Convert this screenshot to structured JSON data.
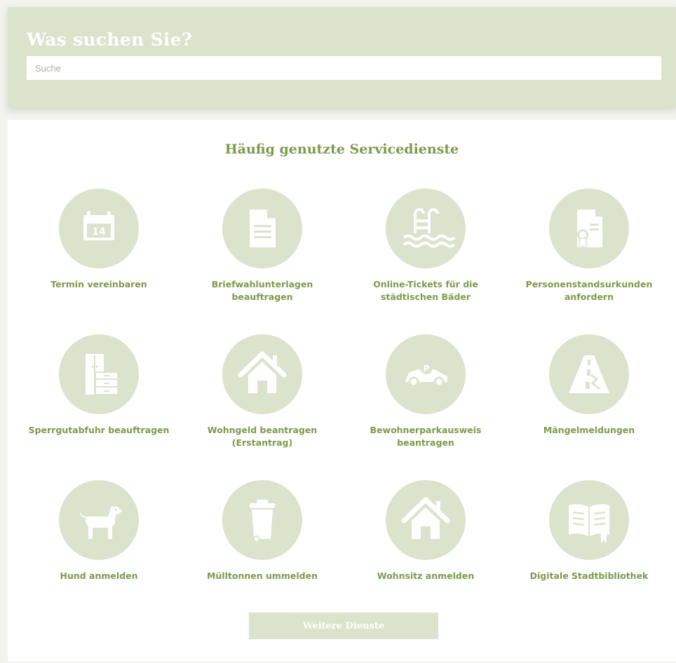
{
  "search": {
    "heading": "Was suchen Sie?",
    "placeholder": "Suche"
  },
  "services": {
    "title": "Häufig genutzte Servicedienste",
    "items": [
      {
        "label": "Termin vereinbaren",
        "icon": "calendar-icon",
        "calendar_day": "14"
      },
      {
        "label": "Briefwahlunterlagen beauftragen",
        "icon": "document-icon"
      },
      {
        "label": "Online-Tickets für die städtischen Bäder",
        "icon": "swimming-pool-icon"
      },
      {
        "label": "Personenstandsurkunden anfordern",
        "icon": "certificate-icon"
      },
      {
        "label": "Sperrgutabfuhr beauftragen",
        "icon": "furniture-icon"
      },
      {
        "label": "Wohngeld beantragen (Erstantrag)",
        "icon": "house-icon"
      },
      {
        "label": "Bewohnerparkausweis beantragen",
        "icon": "parking-car-icon",
        "parking_letter": "P"
      },
      {
        "label": "Mängelmeldungen",
        "icon": "road-damage-icon"
      },
      {
        "label": "Hund anmelden",
        "icon": "dog-icon"
      },
      {
        "label": "Mülltonnen ummelden",
        "icon": "trash-bin-icon"
      },
      {
        "label": "Wohnsitz anmelden",
        "icon": "house-icon"
      },
      {
        "label": "Digitale Stadtbibliothek",
        "icon": "book-icon"
      }
    ],
    "more_label": "Weitere Dienste"
  },
  "colors": {
    "accent_green": "#7d9a4c",
    "icon_background": "#dbe3cc",
    "page_background": "#f3f4ef"
  }
}
